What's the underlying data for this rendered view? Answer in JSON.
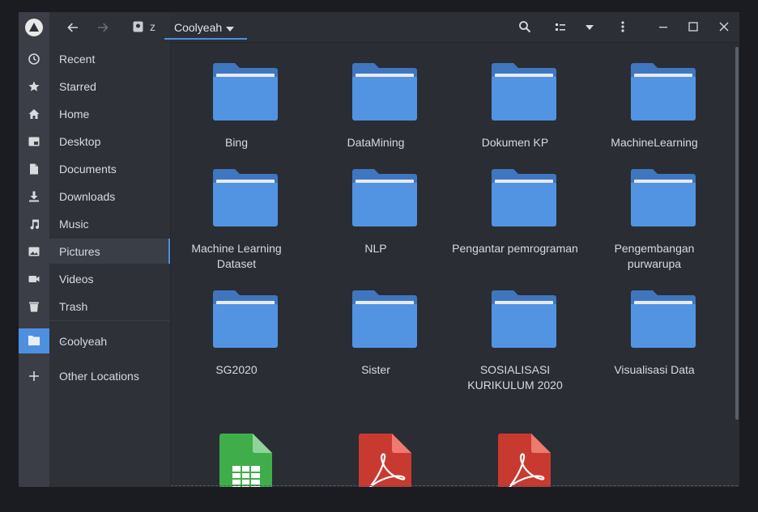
{
  "breadcrumb": {
    "drive_label": "z",
    "current_folder": "Coolyeah"
  },
  "sidebar": {
    "items": [
      {
        "label": "Recent",
        "icon": "clock-icon"
      },
      {
        "label": "Starred",
        "icon": "star-icon"
      },
      {
        "label": "Home",
        "icon": "home-icon"
      },
      {
        "label": "Desktop",
        "icon": "desktop-icon"
      },
      {
        "label": "Documents",
        "icon": "document-icon"
      },
      {
        "label": "Downloads",
        "icon": "download-icon"
      },
      {
        "label": "Music",
        "icon": "music-icon"
      },
      {
        "label": "Pictures",
        "icon": "image-icon"
      },
      {
        "label": "Videos",
        "icon": "video-icon"
      },
      {
        "label": "Trash",
        "icon": "trash-icon"
      }
    ],
    "bookmark": {
      "label": "Coolyeah",
      "icon": "folder-icon"
    },
    "other_locations": {
      "label": "Other Locations",
      "icon": "plus-icon"
    }
  },
  "folders": [
    {
      "name": "Bing"
    },
    {
      "name": "DataMining"
    },
    {
      "name": "Dokumen KP"
    },
    {
      "name": "MachineLearning"
    },
    {
      "name": "Machine Learning Dataset"
    },
    {
      "name": "NLP"
    },
    {
      "name": "Pengantar pemrograman"
    },
    {
      "name": "Pengembangan purwarupa"
    },
    {
      "name": "SG2020"
    },
    {
      "name": "Sister"
    },
    {
      "name": "SOSIALISASI KURIKULUM 2020"
    },
    {
      "name": "Visualisasi Data"
    }
  ],
  "files": [
    {
      "type": "spreadsheet",
      "icon": "spreadsheet-icon"
    },
    {
      "type": "pdf",
      "icon": "pdf-icon"
    },
    {
      "type": "pdf",
      "icon": "pdf-icon"
    }
  ],
  "colors": {
    "accent": "#4f8fe0",
    "folder": "#5294e2",
    "folder_dark": "#3f76c0",
    "spreadsheet": "#3fae4a",
    "pdf": "#c83a30"
  }
}
